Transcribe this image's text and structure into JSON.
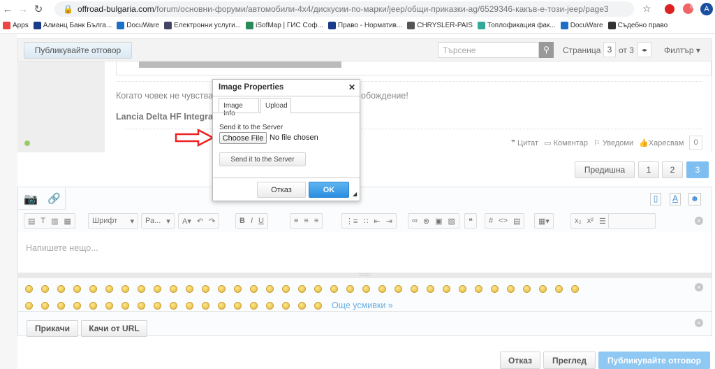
{
  "browser": {
    "url_host": "offroad-bulgaria.com",
    "url_path": "/forum/основни-форуми/автомобили-4х4/дискусии-по-марки/jeep/общи-приказки-ag/6529346-какъв-е-този-jeep/page3",
    "ext_badge": "6",
    "profile": "A"
  },
  "bookmarks": [
    {
      "label": "Apps",
      "color": "#e44"
    },
    {
      "label": "Алианц Банк Бълга...",
      "color": "#1a3a8a"
    },
    {
      "label": "DocuWare",
      "color": "#1b6fc7"
    },
    {
      "label": "Електронни услуги...",
      "color": "#446"
    },
    {
      "label": "iSofMap | ГИС Соф...",
      "color": "#2a8a5a"
    },
    {
      "label": "Право - Норматив...",
      "color": "#1a3a8a"
    },
    {
      "label": "CHRYSLER-PAIS",
      "color": "#555"
    },
    {
      "label": "Топлофикация фак...",
      "color": "#3a9"
    },
    {
      "label": "DocuWare",
      "color": "#1b6fc7"
    },
    {
      "label": "Съдебно право",
      "color": "#333"
    }
  ],
  "topbar": {
    "reply": "Публикувайте отговор",
    "search_placeholder": "Търсене",
    "page_label": "Страница",
    "page_value": "3",
    "page_of": "от 3",
    "filter": "Филтър ▾"
  },
  "post": {
    "signature_text": "Когато човек не чувства",
    "signature_tail": "обождение!",
    "car": "Lancia Delta HF Integra",
    "actions": {
      "quote": "Цитат",
      "comment": "Коментар",
      "notify": "Уведоми",
      "like": "Харесвам",
      "like_count": "0"
    }
  },
  "pagination": {
    "prev": "Предишна",
    "pages": [
      "1",
      "2",
      "3"
    ],
    "current": "3"
  },
  "editor": {
    "font": "Шрифт",
    "size": "Ра...",
    "placeholder": "Напишете нещо...",
    "more_smilies": "Още усмивки »",
    "emoji_row1": 35,
    "emoji_row2": 19,
    "attach": "Прикачи",
    "upload_url": "Качи от URL"
  },
  "footer": {
    "cancel": "Отказ",
    "preview": "Преглед",
    "submit": "Публикувайте отговор"
  },
  "dialog": {
    "title": "Image Properties",
    "tabs": [
      "Image Info",
      "Upload"
    ],
    "active_tab": "Upload",
    "label": "Send it to the Server",
    "choose": "Choose File",
    "no_file": "No file chosen",
    "send": "Send it to the Server",
    "cancel": "Отказ",
    "ok": "OK"
  }
}
